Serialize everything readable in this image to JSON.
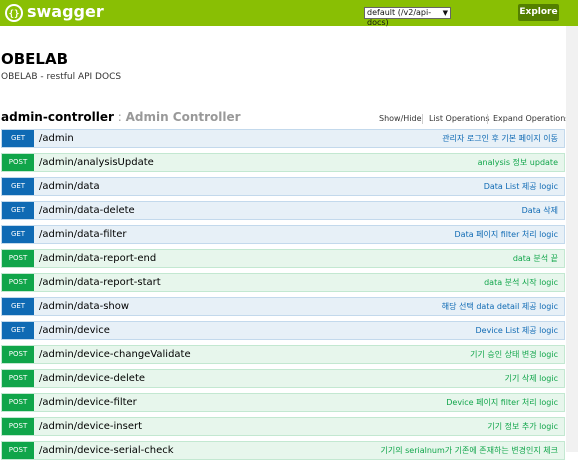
{
  "header": {
    "brand": "swagger",
    "api_select": "default (/v2/api-docs)",
    "explore_label": "Explore"
  },
  "info": {
    "title": "OBELAB",
    "description": "OBELAB - restful API DOCS"
  },
  "controller": {
    "name": "admin-controller",
    "separator": " : ",
    "full_name": "Admin Controller",
    "show_hide": "Show/Hide",
    "list_operations": "List Operations",
    "expand_operations": "Expand Operations"
  },
  "operations": [
    {
      "method": "GET",
      "path": "/admin",
      "summary": "관리자 로그인 후 기본 페이지 이동"
    },
    {
      "method": "POST",
      "path": "/admin/analysisUpdate",
      "summary": "analysis 정보 update"
    },
    {
      "method": "GET",
      "path": "/admin/data",
      "summary": "Data List 제공 logic"
    },
    {
      "method": "GET",
      "path": "/admin/data-delete",
      "summary": "Data 삭제"
    },
    {
      "method": "GET",
      "path": "/admin/data-filter",
      "summary": "Data 페이지 filter 처리 logic"
    },
    {
      "method": "POST",
      "path": "/admin/data-report-end",
      "summary": "data 분석 끝"
    },
    {
      "method": "POST",
      "path": "/admin/data-report-start",
      "summary": "data 분석 시작 logic"
    },
    {
      "method": "GET",
      "path": "/admin/data-show",
      "summary": "해당 선택 data detail 제공 logic"
    },
    {
      "method": "GET",
      "path": "/admin/device",
      "summary": "Device List 제공 logic"
    },
    {
      "method": "POST",
      "path": "/admin/device-changeValidate",
      "summary": "기기 승인 상태 변경 logic"
    },
    {
      "method": "POST",
      "path": "/admin/device-delete",
      "summary": "기기 삭제 logic"
    },
    {
      "method": "POST",
      "path": "/admin/device-filter",
      "summary": "Device 페이지 filter 처리 logic"
    },
    {
      "method": "POST",
      "path": "/admin/device-insert",
      "summary": "기기 정보 추가 logic"
    },
    {
      "method": "POST",
      "path": "/admin/device-serial-check",
      "summary": "기기의 serialnum가 기존에 존재하는 변경인지 체크"
    }
  ]
}
